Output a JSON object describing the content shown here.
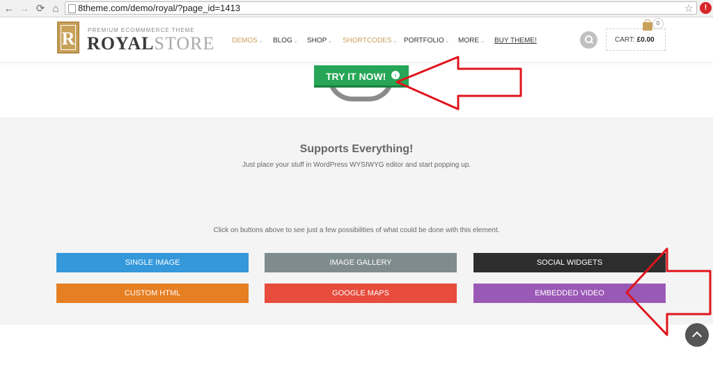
{
  "browser": {
    "url": "8theme.com/demo/royal/?page_id=1413",
    "back_icon": "←",
    "forward_icon": "→",
    "reload_icon": "⟳",
    "home_icon": "⌂",
    "star_icon": "☆",
    "extension_icon": "!"
  },
  "header": {
    "logo_letter": "R",
    "logo_tagline": "PREMIUM ECOMMMERCE THEME",
    "logo_word_1": "ROYAL",
    "logo_word_2": "STORE",
    "menu": [
      {
        "label": "DEMOS",
        "dropdown": true,
        "active": true
      },
      {
        "label": "BLOG",
        "dropdown": true
      },
      {
        "label": "SHOP",
        "dropdown": true
      },
      {
        "label": "SHORTCODES",
        "dropdown": true,
        "active": true
      },
      {
        "label": "PORTFOLIO",
        "dropdown": true
      },
      {
        "label": "MORE",
        "dropdown": true
      },
      {
        "label": "BUY THEME!",
        "dropdown": false
      }
    ],
    "dropdown_glyph": "⌄",
    "cart_label": "CART:",
    "cart_amount": "£0.00",
    "cart_count": "0",
    "accent_color": "#c8a15a"
  },
  "hero": {
    "try_button": "TRY IT NOW!",
    "try_icon": "›",
    "button_color": "#26a656"
  },
  "section": {
    "title": "Supports Everything!",
    "subtitle": "Just place your stuff in WordPress WYSIWYG editor and start popping up.",
    "note": "Click on buttons above to see just a few possibilities of what could be done with this element.",
    "buttons": [
      {
        "label": "SINGLE IMAGE",
        "color": "#3498db"
      },
      {
        "label": "IMAGE GALLERY",
        "color": "#7f8c8d"
      },
      {
        "label": "SOCIAL WIDGETS",
        "color": "#2d2d2d"
      },
      {
        "label": "CUSTOM HTML",
        "color": "#e67e22"
      },
      {
        "label": "GOOGLE MAPS",
        "color": "#e74c3c"
      },
      {
        "label": "EMBEDDED VIDEO",
        "color": "#9b59b6"
      }
    ]
  },
  "annotation_color": "#e0131b"
}
